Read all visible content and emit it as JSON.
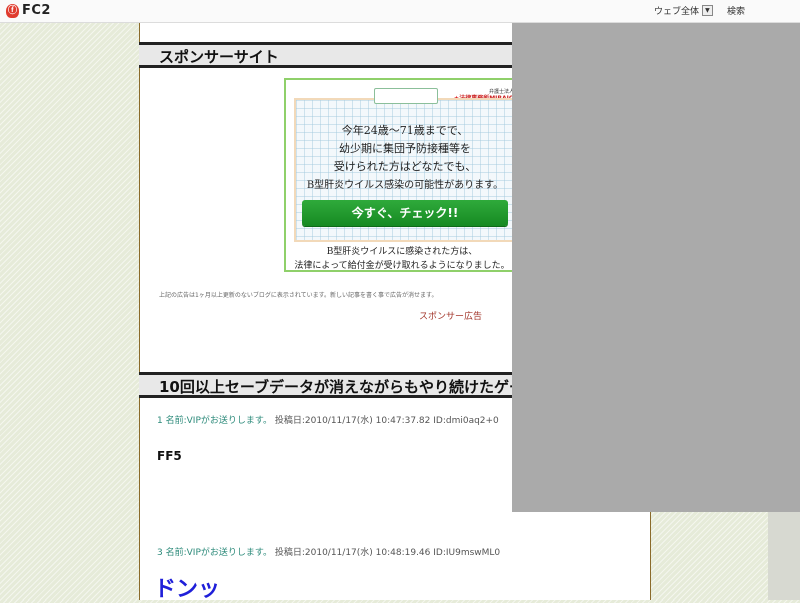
{
  "fc2bar": {
    "logo_mark": "ⓕ",
    "logo_text": "FC2",
    "search_scope": "ウェブ全体",
    "search_dropdown_icon": "chevron-down-icon",
    "search_button": "検索"
  },
  "sponsor_heading": "スポンサーサイト",
  "ad": {
    "firm_tagline": "弁護士法人",
    "firm_name": "法律事務所MIRAIO",
    "lines": [
      "今年24歳〜71歳までで、",
      "幼少期に集団予防接種等を",
      "受けられた方はどなたでも、",
      "B型肝炎ウイルス感染の可能性があります。"
    ],
    "button": "今すぐ、チェック!!",
    "footer": [
      "B型肝炎ウイルスに感染された方は、",
      "法律によって給付金が受け取れるようになりました。"
    ]
  },
  "ad_notice": "上記の広告は1ヶ月以上更新のないブログに表示されています。新しい記事を書く事で広告が消せます。",
  "sponsor_link": "スポンサー広告",
  "article_heading": "10回以上セーブデータが消えながらもやり続けたゲーム",
  "comments": [
    {
      "num": "1",
      "name": "名前:VIPがお送りします。",
      "meta": "投稿日:2010/11/17(水) 10:47:37.82 ID:dmi0aq2+0",
      "body": "FF5"
    },
    {
      "num": "3",
      "name": "名前:VIPがお送りします。",
      "meta": "投稿日:2010/11/17(水) 10:48:19.46 ID:IU9mswML0",
      "body": "ドンッ"
    }
  ]
}
